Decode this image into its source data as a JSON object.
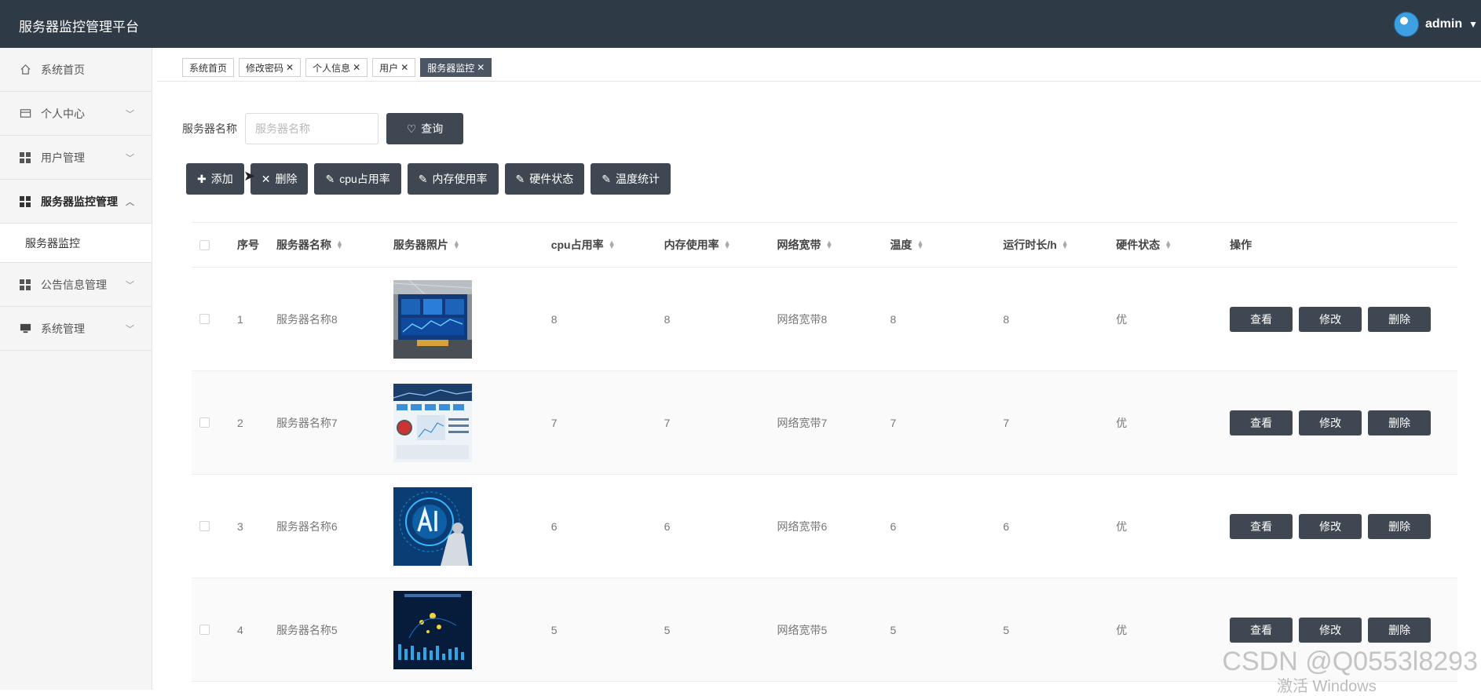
{
  "header": {
    "title": "服务器监控管理平台",
    "user": "admin"
  },
  "sidebar": {
    "items": [
      {
        "label": "系统首页",
        "icon": "home-icon",
        "chevron": ""
      },
      {
        "label": "个人中心",
        "icon": "card-icon",
        "chevron": "down"
      },
      {
        "label": "用户管理",
        "icon": "grid-icon",
        "chevron": "down"
      },
      {
        "label": "服务器监控管理",
        "icon": "grid-icon",
        "chevron": "up"
      },
      {
        "label": "公告信息管理",
        "icon": "grid-icon",
        "chevron": "down"
      },
      {
        "label": "系统管理",
        "icon": "monitor-icon",
        "chevron": "down"
      }
    ],
    "sub_item": "服务器监控"
  },
  "tabs": [
    {
      "label": "系统首页",
      "closable": false,
      "active": false
    },
    {
      "label": "修改密码",
      "closable": true,
      "active": false
    },
    {
      "label": "个人信息",
      "closable": true,
      "active": false
    },
    {
      "label": "用户",
      "closable": true,
      "active": false
    },
    {
      "label": "服务器监控",
      "closable": true,
      "active": true
    }
  ],
  "search": {
    "label": "服务器名称",
    "placeholder": "服务器名称",
    "button": "查询"
  },
  "actions": {
    "add": "添加",
    "delete": "删除",
    "cpu": "cpu占用率",
    "mem": "内存使用率",
    "hw": "硬件状态",
    "temp": "温度统计"
  },
  "table": {
    "headers": {
      "no": "序号",
      "name": "服务器名称",
      "photo": "服务器照片",
      "cpu": "cpu占用率",
      "mem": "内存使用率",
      "bw": "网络宽带",
      "temp": "温度",
      "runtime": "运行时长/h",
      "hw": "硬件状态",
      "op": "操作"
    },
    "rows": [
      {
        "no": "1",
        "name": "服务器名称8",
        "cpu": "8",
        "mem": "8",
        "bw": "网络宽带8",
        "temp": "8",
        "runtime": "8",
        "hw": "优",
        "photo": "server-room-photo"
      },
      {
        "no": "2",
        "name": "服务器名称7",
        "cpu": "7",
        "mem": "7",
        "bw": "网络宽带7",
        "temp": "7",
        "runtime": "7",
        "hw": "优",
        "photo": "dashboard-photo"
      },
      {
        "no": "3",
        "name": "服务器名称6",
        "cpu": "6",
        "mem": "6",
        "bw": "网络宽带6",
        "temp": "6",
        "runtime": "6",
        "hw": "优",
        "photo": "ai-photo"
      },
      {
        "no": "4",
        "name": "服务器名称5",
        "cpu": "5",
        "mem": "5",
        "bw": "网络宽带5",
        "temp": "5",
        "runtime": "5",
        "hw": "优",
        "photo": "data-screen-photo"
      }
    ],
    "op_labels": {
      "view": "查看",
      "edit": "修改",
      "delete": "删除"
    }
  },
  "watermark": "CSDN @Q0553l8293",
  "windows_mark": "激活 Windows"
}
